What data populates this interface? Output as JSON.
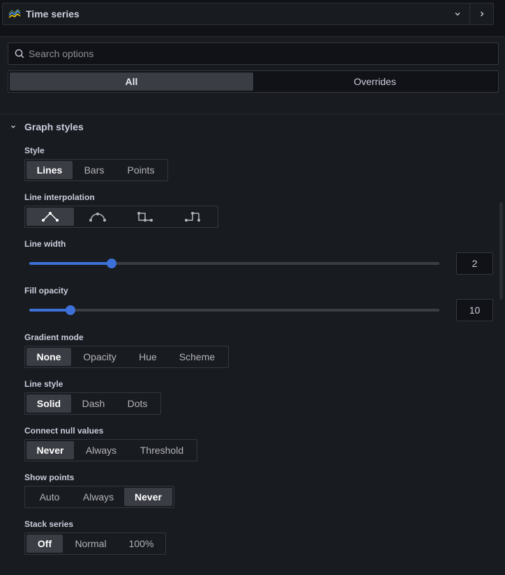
{
  "header": {
    "viz_title": "Time series",
    "viz_icon": "time-series-chart-icon",
    "chevron_icon": "chevron-down-icon",
    "next_icon": "chevron-right-icon"
  },
  "search": {
    "placeholder": "Search options",
    "value": ""
  },
  "tabs": [
    {
      "label": "All",
      "active": true
    },
    {
      "label": "Overrides",
      "active": false
    }
  ],
  "section": {
    "title": "Graph styles",
    "expanded": true
  },
  "style": {
    "label": "Style",
    "options": [
      "Lines",
      "Bars",
      "Points"
    ],
    "selected": "Lines"
  },
  "line_interpolation": {
    "label": "Line interpolation",
    "options": [
      "linear-interpolation-icon",
      "smooth-interpolation-icon",
      "step-before-icon",
      "step-after-icon"
    ],
    "selected": "linear-interpolation-icon"
  },
  "line_width": {
    "label": "Line width",
    "value": "2",
    "min": 0,
    "max": 10
  },
  "fill_opacity": {
    "label": "Fill opacity",
    "value": "10",
    "min": 0,
    "max": 100
  },
  "gradient_mode": {
    "label": "Gradient mode",
    "options": [
      "None",
      "Opacity",
      "Hue",
      "Scheme"
    ],
    "selected": "None"
  },
  "line_style": {
    "label": "Line style",
    "options": [
      "Solid",
      "Dash",
      "Dots"
    ],
    "selected": "Solid"
  },
  "connect_null": {
    "label": "Connect null values",
    "options": [
      "Never",
      "Always",
      "Threshold"
    ],
    "selected": "Never"
  },
  "show_points": {
    "label": "Show points",
    "options": [
      "Auto",
      "Always",
      "Never"
    ],
    "selected": "Never"
  },
  "stack_series": {
    "label": "Stack series",
    "options": [
      "Off",
      "Normal",
      "100%"
    ],
    "selected": "Off"
  },
  "colors": {
    "accent": "#3d71d9",
    "active_bg": "#3a3d44",
    "panel_bg": "#181b1f"
  }
}
